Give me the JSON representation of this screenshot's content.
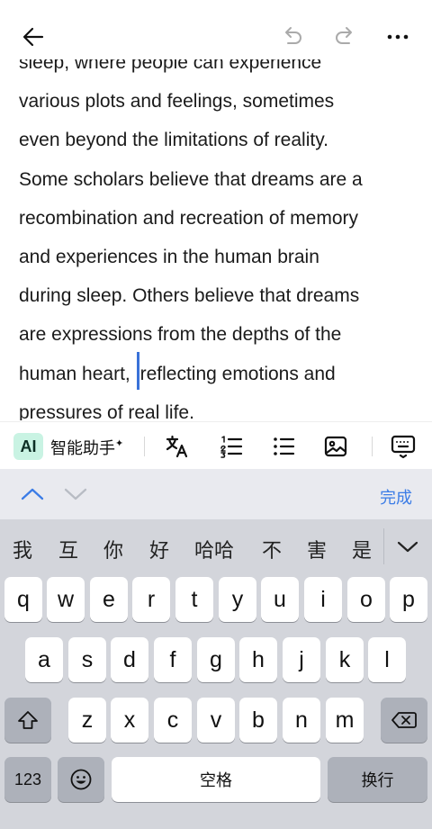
{
  "editor": {
    "lines": [
      "sleep, where people can experience",
      "various plots and feelings, sometimes",
      "even beyond the limitations of reality.",
      "Some scholars believe that dreams are a",
      "recombination and recreation of memory",
      "and experiences in the human brain",
      "during sleep. Others believe that dreams",
      "are expressions from the depths of the"
    ],
    "caret_line_before": "human heart, ",
    "caret_line_after": "reflecting emotions and",
    "last_line": "pressures of real life."
  },
  "toolbar": {
    "ai_badge": "AI",
    "ai_label": "智能助手",
    "ai_star": "✦"
  },
  "keyboard": {
    "done_label": "完成",
    "candidates": [
      "我",
      "互",
      "你",
      "好",
      "哈哈",
      "不",
      "害",
      "是"
    ],
    "row1": [
      "q",
      "w",
      "e",
      "r",
      "t",
      "y",
      "u",
      "i",
      "o",
      "p"
    ],
    "row2": [
      "a",
      "s",
      "d",
      "f",
      "g",
      "h",
      "j",
      "k",
      "l"
    ],
    "row3": [
      "z",
      "x",
      "c",
      "v",
      "b",
      "n",
      "m"
    ],
    "numbers_label": "123",
    "space_label": "空格",
    "return_label": "换行"
  },
  "colors": {
    "accent": "#3b7ce6",
    "caret": "#3a72d8",
    "ai_badge_bg": "#c9f3e3",
    "keyboard_bg": "#d3d5db"
  }
}
